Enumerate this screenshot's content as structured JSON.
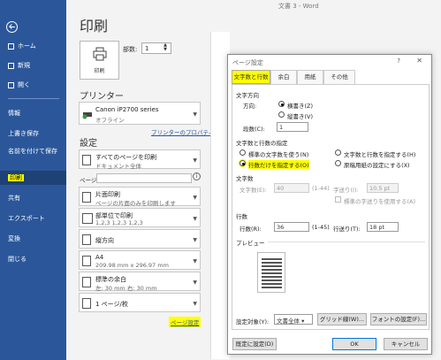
{
  "window": {
    "title": "文書 3  -  Word"
  },
  "sidebar": {
    "items": [
      {
        "label": "ホーム"
      },
      {
        "label": "新規"
      },
      {
        "label": "開く"
      },
      {
        "label": "情報"
      },
      {
        "label": "上書き保存"
      },
      {
        "label": "名前を付けて保存"
      },
      {
        "label": "印刷"
      },
      {
        "label": "共有"
      },
      {
        "label": "エクスポート"
      },
      {
        "label": "変換"
      },
      {
        "label": "閉じる"
      }
    ]
  },
  "print": {
    "heading": "印刷",
    "print_button": "印刷",
    "copies_label": "部数:",
    "copies_value": "1"
  },
  "printer": {
    "heading": "プリンター",
    "name": "Canon iP2700 series",
    "status": "オフライン",
    "properties_link": "プリンターのプロパティ"
  },
  "settings": {
    "heading": "設定",
    "range": {
      "l1": "すべてのページを印刷",
      "l2": "ドキュメント全体"
    },
    "pages_label": "ページ:",
    "sides": {
      "l1": "片面印刷",
      "l2": "ページの片面のみを印刷します"
    },
    "collate": {
      "l1": "部単位で印刷",
      "l2": "1,2,3    1,2,3    1,2,3"
    },
    "orientation": {
      "l1": "縦方向"
    },
    "paper": {
      "l1": "A4",
      "l2": "209.98 mm x 296.97 mm"
    },
    "margins": {
      "l1": "標準の余白",
      "l2": "左:  30 mm    右:  30 mm"
    },
    "pages_per_sheet": {
      "l1": "1 ページ/枚"
    },
    "page_setup_link": "ページ設定"
  },
  "dialog": {
    "title": "ページ設定",
    "help": "?",
    "close": "✕",
    "tabs": [
      "文字数と行数",
      "余白",
      "用紙",
      "その他"
    ],
    "text_direction": {
      "heading": "文字方向",
      "direction_label": "方向:",
      "horizontal": "横書き(Z)",
      "vertical": "縦書き(V)",
      "columns_label": "段数(C):",
      "columns_value": "1"
    },
    "grid": {
      "heading": "文字数と行数の指定",
      "opt1": "標準の文字数を使う(N)",
      "opt2": "文字数と行数を指定する(H)",
      "opt3": "行数だけを指定する(O)",
      "opt4": "原稿用紙の設定にする(X)"
    },
    "chars": {
      "heading": "文字数",
      "count_label": "文字数(E):",
      "count_value": "40",
      "count_range": "(1-44)",
      "pitch_label": "字送り(I):",
      "pitch_value": "10.5 pt",
      "default_pitch": "標準の字送りを使用する(A)"
    },
    "lines": {
      "heading": "行数",
      "count_label": "行数(R):",
      "count_value": "36",
      "count_range": "(1-45)",
      "pitch_label": "行送り(T):",
      "pitch_value": "18 pt"
    },
    "preview_heading": "プレビュー",
    "apply_label": "設定対象(Y):",
    "apply_value": "文書全体",
    "grid_btn": "グリッド線(W)...",
    "font_btn": "フォントの設定(F)...",
    "default_btn": "既定に設定(D)",
    "ok": "OK",
    "cancel": "キャンセル"
  }
}
